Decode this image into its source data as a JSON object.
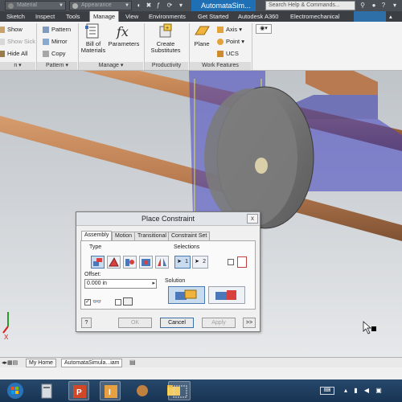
{
  "colors": {
    "doc_tab_blue": "#1f6fb4",
    "dark_chrome": "#3b3f44",
    "ribbon_bg": "#f3f3f3",
    "selection_blue": "#c9dcef",
    "pipe_copper": "#b8784a",
    "disc_gray": "#6f6f6f",
    "highlight_blue": "#4040c0"
  },
  "titlebar": {
    "material_select": "Material",
    "appearance_select": "Appearance",
    "doc_title": "AutomataSim...",
    "search_placeholder": "Search Help & Commands..."
  },
  "menu": {
    "tabs": [
      "Sketch",
      "Inspect",
      "Tools",
      "Manage",
      "View",
      "Environments",
      "Get Started",
      "Autodesk A360",
      "Electromechanical"
    ],
    "active_tab": "Manage"
  },
  "ribbon": {
    "visibility": {
      "show": "Show",
      "show_sick": "Show Sick",
      "hide_all": "Hide All"
    },
    "pattern": {
      "pattern": "Pattern",
      "mirror": "Mirror",
      "copy": "Copy"
    },
    "manage": {
      "bom_line1": "Bill of",
      "bom_line2": "Materials",
      "parameters": "Parameters"
    },
    "productivity": {
      "create_line1": "Create",
      "create_line2": "Substitutes"
    },
    "work_features": {
      "plane": "Plane",
      "axis": "Axis",
      "point": "Point",
      "ucs": "UCS"
    },
    "footers": {
      "left": "n ▾",
      "pattern": "Pattern ▾",
      "manage": "Manage ▾",
      "productivity": "Productivity",
      "work_features": "Work Features"
    }
  },
  "dialog": {
    "title": "Place Constraint",
    "close": "x",
    "tabs": [
      "Assembly",
      "Motion",
      "Transitional",
      "Constraint Set"
    ],
    "active_tab": "Assembly",
    "type_label": "Type",
    "selections_label": "Selections",
    "selection1": "1",
    "selection2": "2",
    "offset_label": "Offset:",
    "offset_value": "0.000 in",
    "solution_label": "Solution",
    "ok": "OK",
    "cancel": "Cancel",
    "apply": "Apply",
    "more": ">>",
    "help": "?"
  },
  "bottom_tabs": {
    "my_home": "My Home",
    "document": "AutomataSimula...iam"
  },
  "axis_labels": {
    "x": "X"
  },
  "taskbar_apps": [
    "Internet Explorer",
    "File Explorer",
    "PowerPoint",
    "Autodesk Inventor",
    "Unknown App",
    "Folder",
    "Screen Capture"
  ]
}
